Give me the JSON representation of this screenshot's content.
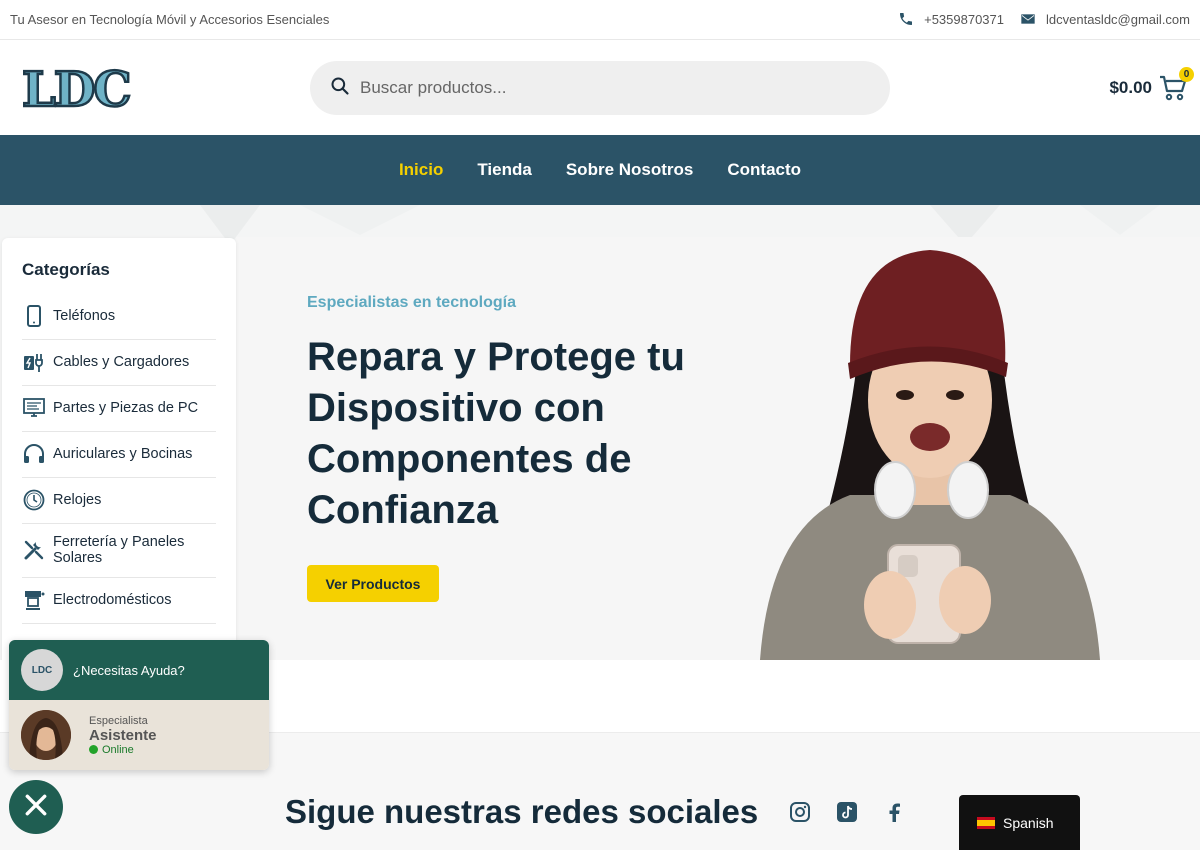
{
  "topbar": {
    "tagline": "Tu Asesor en Tecnología Móvil y Accesorios Esenciales",
    "phone": "+5359870371",
    "email": "ldcventasldc@gmail.com"
  },
  "header": {
    "logo_text": "LDC",
    "search_placeholder": "Buscar productos...",
    "cart_total": "$0.00",
    "cart_count": "0"
  },
  "nav": {
    "items": [
      {
        "label": "Inicio",
        "active": true
      },
      {
        "label": "Tienda",
        "active": false
      },
      {
        "label": "Sobre Nosotros",
        "active": false
      },
      {
        "label": "Contacto",
        "active": false
      }
    ]
  },
  "sidebar": {
    "title": "Categorías",
    "items": [
      {
        "label": "Teléfonos",
        "icon": "phone-icon"
      },
      {
        "label": "Cables y Cargadores",
        "icon": "charger-icon"
      },
      {
        "label": "Partes y Piezas de PC",
        "icon": "monitor-icon"
      },
      {
        "label": "Auriculares y Bocinas",
        "icon": "headphones-icon"
      },
      {
        "label": "Relojes",
        "icon": "clock-icon"
      },
      {
        "label": "Ferretería y Paneles Solares",
        "icon": "tools-icon"
      },
      {
        "label": "Electrodomésticos",
        "icon": "appliance-icon"
      }
    ]
  },
  "hero": {
    "eyebrow": "Especialistas en tecnología",
    "headline": "Repara y Protege tu Dispositivo con Componentes de Confianza",
    "cta": "Ver Productos"
  },
  "social": {
    "title": "Sigue nuestras redes sociales",
    "icons": [
      "instagram-icon",
      "tiktok-icon",
      "facebook-icon"
    ]
  },
  "chat": {
    "question": "¿Necesitas Ayuda?",
    "logo_text": "LDC",
    "agent_role": "Especialista",
    "agent_name": "Asistente",
    "agent_status": "Online"
  },
  "language": {
    "label": "Spanish"
  },
  "colors": {
    "nav_bg": "#2b5367",
    "accent_yellow": "#f5d000",
    "eyebrow_teal": "#5ea9c0",
    "chat_green": "#1f5e52"
  }
}
